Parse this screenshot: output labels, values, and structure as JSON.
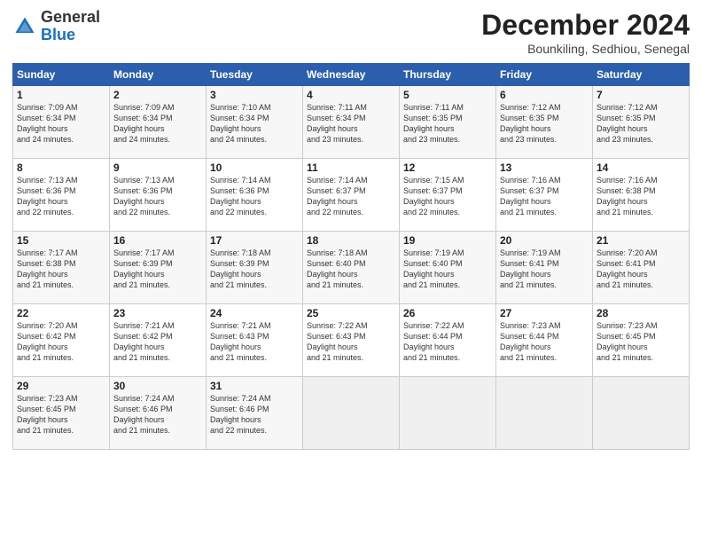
{
  "logo": {
    "general": "General",
    "blue": "Blue"
  },
  "title": "December 2024",
  "location": "Bounkiling, Sedhiou, Senegal",
  "days_of_week": [
    "Sunday",
    "Monday",
    "Tuesday",
    "Wednesday",
    "Thursday",
    "Friday",
    "Saturday"
  ],
  "weeks": [
    [
      {
        "day": "1",
        "sunrise": "7:09 AM",
        "sunset": "6:34 PM",
        "daylight": "11 hours and 24 minutes."
      },
      {
        "day": "2",
        "sunrise": "7:09 AM",
        "sunset": "6:34 PM",
        "daylight": "11 hours and 24 minutes."
      },
      {
        "day": "3",
        "sunrise": "7:10 AM",
        "sunset": "6:34 PM",
        "daylight": "11 hours and 24 minutes."
      },
      {
        "day": "4",
        "sunrise": "7:11 AM",
        "sunset": "6:34 PM",
        "daylight": "11 hours and 23 minutes."
      },
      {
        "day": "5",
        "sunrise": "7:11 AM",
        "sunset": "6:35 PM",
        "daylight": "11 hours and 23 minutes."
      },
      {
        "day": "6",
        "sunrise": "7:12 AM",
        "sunset": "6:35 PM",
        "daylight": "11 hours and 23 minutes."
      },
      {
        "day": "7",
        "sunrise": "7:12 AM",
        "sunset": "6:35 PM",
        "daylight": "11 hours and 23 minutes."
      }
    ],
    [
      {
        "day": "8",
        "sunrise": "7:13 AM",
        "sunset": "6:36 PM",
        "daylight": "11 hours and 22 minutes."
      },
      {
        "day": "9",
        "sunrise": "7:13 AM",
        "sunset": "6:36 PM",
        "daylight": "11 hours and 22 minutes."
      },
      {
        "day": "10",
        "sunrise": "7:14 AM",
        "sunset": "6:36 PM",
        "daylight": "11 hours and 22 minutes."
      },
      {
        "day": "11",
        "sunrise": "7:14 AM",
        "sunset": "6:37 PM",
        "daylight": "11 hours and 22 minutes."
      },
      {
        "day": "12",
        "sunrise": "7:15 AM",
        "sunset": "6:37 PM",
        "daylight": "11 hours and 22 minutes."
      },
      {
        "day": "13",
        "sunrise": "7:16 AM",
        "sunset": "6:37 PM",
        "daylight": "11 hours and 21 minutes."
      },
      {
        "day": "14",
        "sunrise": "7:16 AM",
        "sunset": "6:38 PM",
        "daylight": "11 hours and 21 minutes."
      }
    ],
    [
      {
        "day": "15",
        "sunrise": "7:17 AM",
        "sunset": "6:38 PM",
        "daylight": "11 hours and 21 minutes."
      },
      {
        "day": "16",
        "sunrise": "7:17 AM",
        "sunset": "6:39 PM",
        "daylight": "11 hours and 21 minutes."
      },
      {
        "day": "17",
        "sunrise": "7:18 AM",
        "sunset": "6:39 PM",
        "daylight": "11 hours and 21 minutes."
      },
      {
        "day": "18",
        "sunrise": "7:18 AM",
        "sunset": "6:40 PM",
        "daylight": "11 hours and 21 minutes."
      },
      {
        "day": "19",
        "sunrise": "7:19 AM",
        "sunset": "6:40 PM",
        "daylight": "11 hours and 21 minutes."
      },
      {
        "day": "20",
        "sunrise": "7:19 AM",
        "sunset": "6:41 PM",
        "daylight": "11 hours and 21 minutes."
      },
      {
        "day": "21",
        "sunrise": "7:20 AM",
        "sunset": "6:41 PM",
        "daylight": "11 hours and 21 minutes."
      }
    ],
    [
      {
        "day": "22",
        "sunrise": "7:20 AM",
        "sunset": "6:42 PM",
        "daylight": "11 hours and 21 minutes."
      },
      {
        "day": "23",
        "sunrise": "7:21 AM",
        "sunset": "6:42 PM",
        "daylight": "11 hours and 21 minutes."
      },
      {
        "day": "24",
        "sunrise": "7:21 AM",
        "sunset": "6:43 PM",
        "daylight": "11 hours and 21 minutes."
      },
      {
        "day": "25",
        "sunrise": "7:22 AM",
        "sunset": "6:43 PM",
        "daylight": "11 hours and 21 minutes."
      },
      {
        "day": "26",
        "sunrise": "7:22 AM",
        "sunset": "6:44 PM",
        "daylight": "11 hours and 21 minutes."
      },
      {
        "day": "27",
        "sunrise": "7:23 AM",
        "sunset": "6:44 PM",
        "daylight": "11 hours and 21 minutes."
      },
      {
        "day": "28",
        "sunrise": "7:23 AM",
        "sunset": "6:45 PM",
        "daylight": "11 hours and 21 minutes."
      }
    ],
    [
      {
        "day": "29",
        "sunrise": "7:23 AM",
        "sunset": "6:45 PM",
        "daylight": "11 hours and 21 minutes."
      },
      {
        "day": "30",
        "sunrise": "7:24 AM",
        "sunset": "6:46 PM",
        "daylight": "11 hours and 21 minutes."
      },
      {
        "day": "31",
        "sunrise": "7:24 AM",
        "sunset": "6:46 PM",
        "daylight": "11 hours and 22 minutes."
      },
      null,
      null,
      null,
      null
    ]
  ]
}
